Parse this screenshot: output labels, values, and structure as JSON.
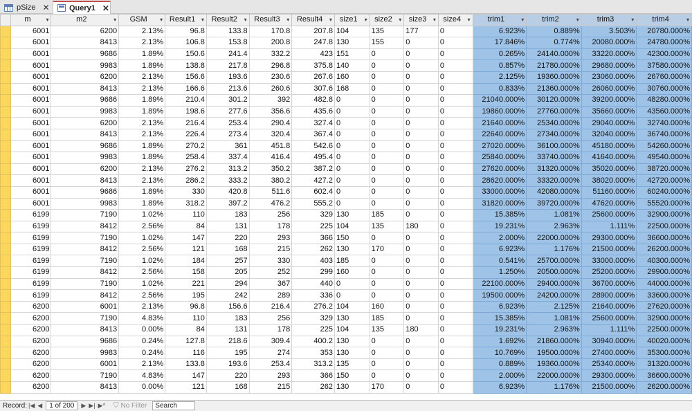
{
  "tabs": [
    {
      "label": "pSize",
      "icon": "table-icon",
      "active": false
    },
    {
      "label": "Query1",
      "icon": "query-icon",
      "active": true
    }
  ],
  "columns": [
    "m",
    "m2",
    "GSM",
    "Result1",
    "Result2",
    "Result3",
    "Result4",
    "size1",
    "size2",
    "size3",
    "size4",
    "trim1",
    "trim2",
    "trim3",
    "trim4"
  ],
  "rows": [
    [
      "6001",
      "6200",
      "2.13%",
      "96.8",
      "133.8",
      "170.8",
      "207.8",
      "104",
      "135",
      "177",
      "0",
      "6.923%",
      "0.889%",
      "3.503%",
      "20780.000%"
    ],
    [
      "6001",
      "8413",
      "2.13%",
      "106.8",
      "153.8",
      "200.8",
      "247.8",
      "130",
      "155",
      "0",
      "0",
      "17.846%",
      "0.774%",
      "20080.000%",
      "24780.000%"
    ],
    [
      "6001",
      "9686",
      "1.89%",
      "150.6",
      "241.4",
      "332.2",
      "423",
      "151",
      "0",
      "0",
      "0",
      "0.265%",
      "24140.000%",
      "33220.000%",
      "42300.000%"
    ],
    [
      "6001",
      "9983",
      "1.89%",
      "138.8",
      "217.8",
      "296.8",
      "375.8",
      "140",
      "0",
      "0",
      "0",
      "0.857%",
      "21780.000%",
      "29680.000%",
      "37580.000%"
    ],
    [
      "6001",
      "6200",
      "2.13%",
      "156.6",
      "193.6",
      "230.6",
      "267.6",
      "160",
      "0",
      "0",
      "0",
      "2.125%",
      "19360.000%",
      "23060.000%",
      "26760.000%"
    ],
    [
      "6001",
      "8413",
      "2.13%",
      "166.6",
      "213.6",
      "260.6",
      "307.6",
      "168",
      "0",
      "0",
      "0",
      "0.833%",
      "21360.000%",
      "26060.000%",
      "30760.000%"
    ],
    [
      "6001",
      "9686",
      "1.89%",
      "210.4",
      "301.2",
      "392",
      "482.8",
      "0",
      "0",
      "0",
      "0",
      "21040.000%",
      "30120.000%",
      "39200.000%",
      "48280.000%"
    ],
    [
      "6001",
      "9983",
      "1.89%",
      "198.6",
      "277.6",
      "356.6",
      "435.6",
      "0",
      "0",
      "0",
      "0",
      "19860.000%",
      "27760.000%",
      "35660.000%",
      "43560.000%"
    ],
    [
      "6001",
      "6200",
      "2.13%",
      "216.4",
      "253.4",
      "290.4",
      "327.4",
      "0",
      "0",
      "0",
      "0",
      "21640.000%",
      "25340.000%",
      "29040.000%",
      "32740.000%"
    ],
    [
      "6001",
      "8413",
      "2.13%",
      "226.4",
      "273.4",
      "320.4",
      "367.4",
      "0",
      "0",
      "0",
      "0",
      "22640.000%",
      "27340.000%",
      "32040.000%",
      "36740.000%"
    ],
    [
      "6001",
      "9686",
      "1.89%",
      "270.2",
      "361",
      "451.8",
      "542.6",
      "0",
      "0",
      "0",
      "0",
      "27020.000%",
      "36100.000%",
      "45180.000%",
      "54260.000%"
    ],
    [
      "6001",
      "9983",
      "1.89%",
      "258.4",
      "337.4",
      "416.4",
      "495.4",
      "0",
      "0",
      "0",
      "0",
      "25840.000%",
      "33740.000%",
      "41640.000%",
      "49540.000%"
    ],
    [
      "6001",
      "6200",
      "2.13%",
      "276.2",
      "313.2",
      "350.2",
      "387.2",
      "0",
      "0",
      "0",
      "0",
      "27620.000%",
      "31320.000%",
      "35020.000%",
      "38720.000%"
    ],
    [
      "6001",
      "8413",
      "2.13%",
      "286.2",
      "333.2",
      "380.2",
      "427.2",
      "0",
      "0",
      "0",
      "0",
      "28620.000%",
      "33320.000%",
      "38020.000%",
      "42720.000%"
    ],
    [
      "6001",
      "9686",
      "1.89%",
      "330",
      "420.8",
      "511.6",
      "602.4",
      "0",
      "0",
      "0",
      "0",
      "33000.000%",
      "42080.000%",
      "51160.000%",
      "60240.000%"
    ],
    [
      "6001",
      "9983",
      "1.89%",
      "318.2",
      "397.2",
      "476.2",
      "555.2",
      "0",
      "0",
      "0",
      "0",
      "31820.000%",
      "39720.000%",
      "47620.000%",
      "55520.000%"
    ],
    [
      "6199",
      "7190",
      "1.02%",
      "110",
      "183",
      "256",
      "329",
      "130",
      "185",
      "0",
      "0",
      "15.385%",
      "1.081%",
      "25600.000%",
      "32900.000%"
    ],
    [
      "6199",
      "8412",
      "2.56%",
      "84",
      "131",
      "178",
      "225",
      "104",
      "135",
      "180",
      "0",
      "19.231%",
      "2.963%",
      "1.111%",
      "22500.000%"
    ],
    [
      "6199",
      "7190",
      "1.02%",
      "147",
      "220",
      "293",
      "366",
      "150",
      "0",
      "0",
      "0",
      "2.000%",
      "22000.000%",
      "29300.000%",
      "36600.000%"
    ],
    [
      "6199",
      "8412",
      "2.56%",
      "121",
      "168",
      "215",
      "262",
      "130",
      "170",
      "0",
      "0",
      "6.923%",
      "1.176%",
      "21500.000%",
      "26200.000%"
    ],
    [
      "6199",
      "7190",
      "1.02%",
      "184",
      "257",
      "330",
      "403",
      "185",
      "0",
      "0",
      "0",
      "0.541%",
      "25700.000%",
      "33000.000%",
      "40300.000%"
    ],
    [
      "6199",
      "8412",
      "2.56%",
      "158",
      "205",
      "252",
      "299",
      "160",
      "0",
      "0",
      "0",
      "1.250%",
      "20500.000%",
      "25200.000%",
      "29900.000%"
    ],
    [
      "6199",
      "7190",
      "1.02%",
      "221",
      "294",
      "367",
      "440",
      "0",
      "0",
      "0",
      "0",
      "22100.000%",
      "29400.000%",
      "36700.000%",
      "44000.000%"
    ],
    [
      "6199",
      "8412",
      "2.56%",
      "195",
      "242",
      "289",
      "336",
      "0",
      "0",
      "0",
      "0",
      "19500.000%",
      "24200.000%",
      "28900.000%",
      "33600.000%"
    ],
    [
      "6200",
      "6001",
      "2.13%",
      "96.8",
      "156.6",
      "216.4",
      "276.2",
      "104",
      "160",
      "0",
      "0",
      "6.923%",
      "2.125%",
      "21640.000%",
      "27620.000%"
    ],
    [
      "6200",
      "7190",
      "4.83%",
      "110",
      "183",
      "256",
      "329",
      "130",
      "185",
      "0",
      "0",
      "15.385%",
      "1.081%",
      "25600.000%",
      "32900.000%"
    ],
    [
      "6200",
      "8413",
      "0.00%",
      "84",
      "131",
      "178",
      "225",
      "104",
      "135",
      "180",
      "0",
      "19.231%",
      "2.963%",
      "1.111%",
      "22500.000%"
    ],
    [
      "6200",
      "9686",
      "0.24%",
      "127.8",
      "218.6",
      "309.4",
      "400.2",
      "130",
      "0",
      "0",
      "0",
      "1.692%",
      "21860.000%",
      "30940.000%",
      "40020.000%"
    ],
    [
      "6200",
      "9983",
      "0.24%",
      "116",
      "195",
      "274",
      "353",
      "130",
      "0",
      "0",
      "0",
      "10.769%",
      "19500.000%",
      "27400.000%",
      "35300.000%"
    ],
    [
      "6200",
      "6001",
      "2.13%",
      "133.8",
      "193.6",
      "253.4",
      "313.2",
      "135",
      "0",
      "0",
      "0",
      "0.889%",
      "19360.000%",
      "25340.000%",
      "31320.000%"
    ],
    [
      "6200",
      "7190",
      "4.83%",
      "147",
      "220",
      "293",
      "366",
      "150",
      "0",
      "0",
      "0",
      "2.000%",
      "22000.000%",
      "29300.000%",
      "36600.000%"
    ],
    [
      "6200",
      "8413",
      "0.00%",
      "121",
      "168",
      "215",
      "262",
      "130",
      "170",
      "0",
      "0",
      "6.923%",
      "1.176%",
      "21500.000%",
      "26200.000%"
    ]
  ],
  "status": {
    "record_label": "Record:",
    "record_position": "1 of 200",
    "filter_label": "No Filter",
    "search_placeholder": "Search"
  }
}
